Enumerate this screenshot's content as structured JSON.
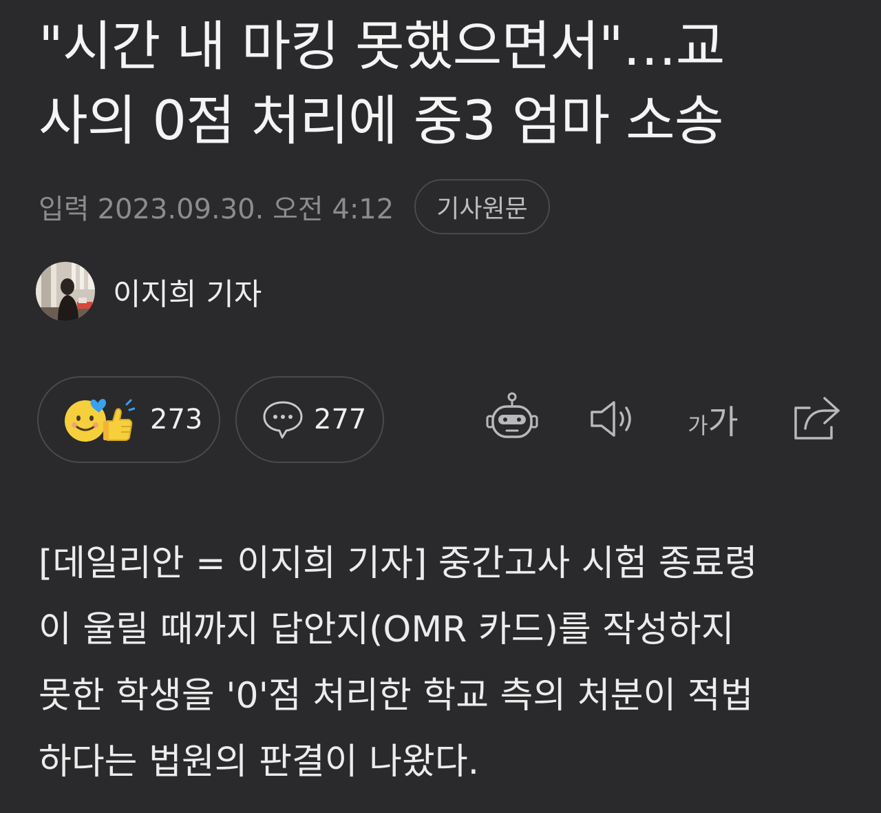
{
  "article": {
    "headline_lines": [
      "\"시간 내 마킹 못했으면서\"…교",
      "사의 0점 처리에 중3 엄마 소송"
    ],
    "date_label": "입력",
    "date_value": "2023.09.30. 오전 4:12",
    "original_button": "기사원문",
    "reporter_name": "이지희 기자",
    "body_lines": [
      "[데일리안 = 이지희 기자] 중간고사 시험 종료령",
      "이 울릴 때까지 답안지(OMR 카드)를 작성하지",
      "못한 학생을 '0'점 처리한 학교 측의 처분이 적법",
      "하다는 법원의 판결이 나왔다."
    ]
  },
  "actions": {
    "like_count": "273",
    "comment_count": "277",
    "font_small_glyph": "가",
    "font_big_glyph": "가"
  },
  "colors": {
    "background": "#2a2a2c",
    "text_primary": "#f4f4f4",
    "text_muted": "#8c8c8c",
    "pill_border": "#4a4a4c",
    "emoji_yellow": "#f6cf3c",
    "emoji_blue": "#3aa0f0"
  },
  "icons": {
    "like": "smiley-thumbs-up-icon",
    "comment": "speech-bubble-icon",
    "bot": "robot-icon",
    "audio": "speaker-icon",
    "font": "font-size-icon",
    "share": "share-icon"
  }
}
